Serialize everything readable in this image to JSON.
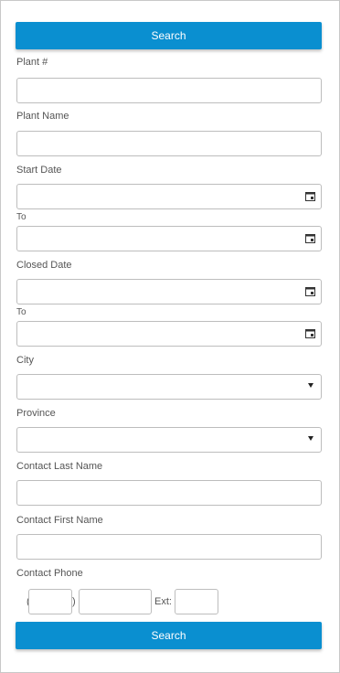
{
  "buttons": {
    "search_top": "Search",
    "search_bottom": "Search"
  },
  "fields": {
    "plant_number": {
      "label": "Plant #",
      "value": ""
    },
    "plant_name": {
      "label": "Plant Name",
      "value": ""
    },
    "start_date": {
      "label": "Start Date",
      "to_label": "To",
      "from_value": "",
      "to_value": ""
    },
    "closed_date": {
      "label": "Closed Date",
      "to_label": "To",
      "from_value": "",
      "to_value": ""
    },
    "city": {
      "label": "City",
      "selected": ""
    },
    "province": {
      "label": "Province",
      "selected": ""
    },
    "contact_last_name": {
      "label": "Contact Last Name",
      "value": ""
    },
    "contact_first_name": {
      "label": "Contact First Name",
      "value": ""
    },
    "contact_phone": {
      "label": "Contact Phone",
      "open_paren": "(",
      "close_paren": ")",
      "ext_label": "Ext:"
    }
  },
  "icons": {
    "date": "calendar-icon",
    "dropdown": "caret-down-icon"
  },
  "colors": {
    "primary": "#0a8fd0",
    "border": "#bdbdbd"
  }
}
